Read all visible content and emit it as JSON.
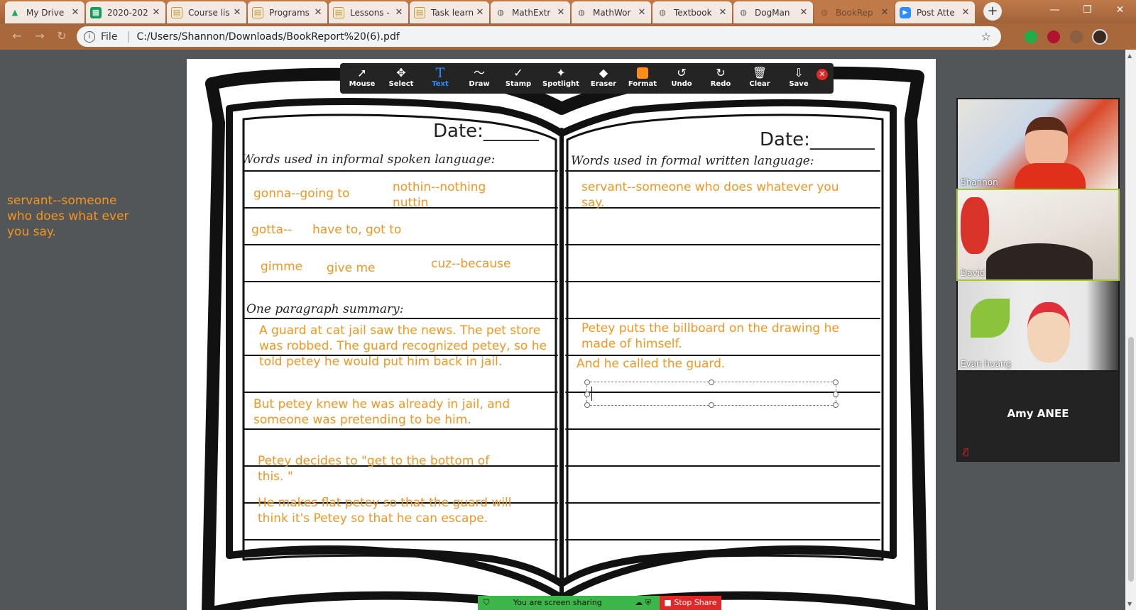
{
  "browser": {
    "tabs": [
      {
        "title": "My Drive",
        "favicon": "google-drive-icon",
        "color": "#1fa463"
      },
      {
        "title": "2020-202",
        "favicon": "google-sheets-icon",
        "color": "#0f9d58"
      },
      {
        "title": "Course lis",
        "favicon": "doc-icon",
        "color": "#c69a2a"
      },
      {
        "title": "Programs",
        "favicon": "doc-icon",
        "color": "#c69a2a"
      },
      {
        "title": "Lessons -",
        "favicon": "doc-icon",
        "color": "#c69a2a"
      },
      {
        "title": "Task learn",
        "favicon": "doc-icon",
        "color": "#c69a2a"
      },
      {
        "title": "MathExtr",
        "favicon": "globe-icon",
        "color": "#666666"
      },
      {
        "title": "MathWor",
        "favicon": "globe-icon",
        "color": "#666666"
      },
      {
        "title": "Textbook",
        "favicon": "globe-icon",
        "color": "#666666"
      },
      {
        "title": "DogMan",
        "favicon": "globe-icon",
        "color": "#666666"
      },
      {
        "title": "BookRep",
        "favicon": "globe-icon",
        "color": "#8a5a3a",
        "active": true
      },
      {
        "title": "Post Atte",
        "favicon": "zoom-icon",
        "color": "#2d8cff"
      }
    ],
    "new_tab": "+",
    "address": {
      "scheme": "File",
      "url": "C:/Users/Shannon/Downloads/BookReport%20(6).pdf"
    }
  },
  "annotation_toolbar": {
    "tools": [
      {
        "label": "Mouse",
        "icon": "cursor-icon"
      },
      {
        "label": "Select",
        "icon": "move-icon"
      },
      {
        "label": "Text",
        "icon": "text-icon",
        "active": true
      },
      {
        "label": "Draw",
        "icon": "squiggle-icon"
      },
      {
        "label": "Stamp",
        "icon": "check-icon"
      },
      {
        "label": "Spotlight",
        "icon": "wand-icon"
      },
      {
        "label": "Eraser",
        "icon": "eraser-icon"
      },
      {
        "label": "Format",
        "icon": "color-swatch-icon"
      },
      {
        "label": "Undo",
        "icon": "undo-icon"
      },
      {
        "label": "Redo",
        "icon": "redo-icon"
      },
      {
        "label": "Clear",
        "icon": "trash-icon"
      },
      {
        "label": "Save",
        "icon": "save-icon"
      }
    ],
    "accent": "#2d8cff",
    "format_color": "#ff8c1a"
  },
  "side_note": "servant--someone who does what ever you say.",
  "worksheet": {
    "left_date": "Date:______",
    "right_date": "Date:_______",
    "left_heading": "Words used in informal spoken language:",
    "right_heading": "Words used in formal written language:",
    "summary_heading": "One paragraph summary:",
    "left_annotations": [
      "gonna--going to",
      "nothin--nothing\nnuttin",
      "gotta--",
      "have to, got to",
      "gimme",
      "give me",
      "cuz--because",
      "A guard at cat jail saw the news. The pet store was robbed. The guard recognized petey, so he told petey he would put him back in jail.",
      "But petey knew he was already in jail, and someone was pretending to be him.",
      "Petey decides to \"get to the bottom of this. \"",
      "He makes flat petey so that the guard will think it's Petey so that he can escape."
    ],
    "right_annotations": [
      "servant--someone who does whatever you say.",
      "Petey puts the billboard on the drawing he made of himself.",
      "And he called the guard."
    ],
    "annotation_color": "#f7941d"
  },
  "participants": [
    {
      "name": "Shannon",
      "speaking": false
    },
    {
      "name": "David",
      "speaking": true
    },
    {
      "name": "Evan huang",
      "speaking": false
    },
    {
      "name": "Amy ANEE",
      "muted": true
    }
  ],
  "share_bar": {
    "status": "You are screen sharing",
    "stop_label": "Stop Share",
    "status_color": "#3cb64a",
    "stop_color": "#e02828"
  }
}
